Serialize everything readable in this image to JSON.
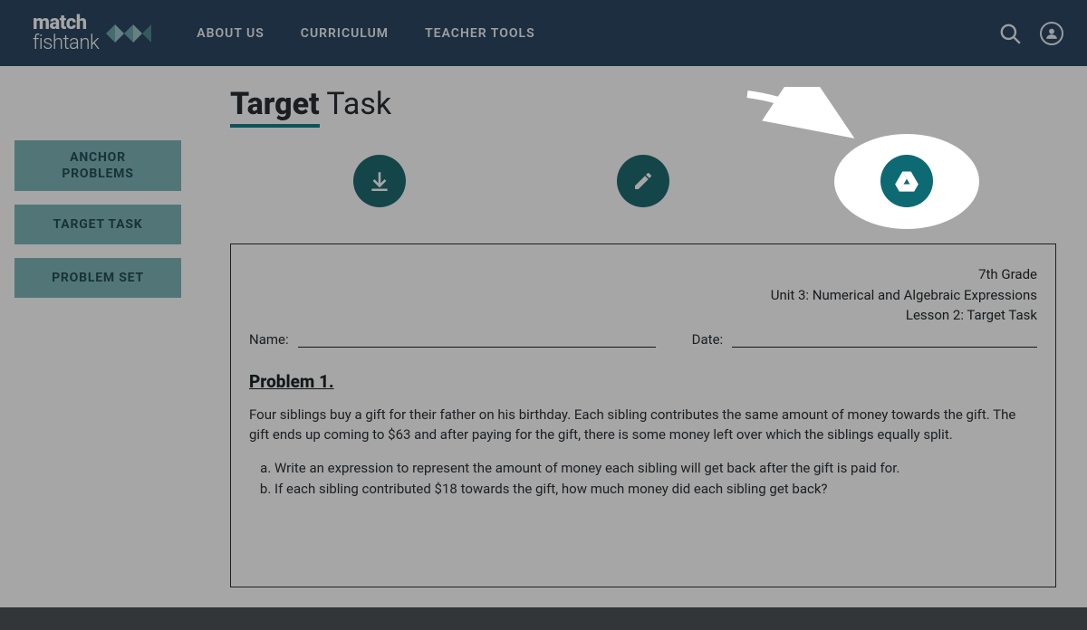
{
  "brand": {
    "bold": "match",
    "thin": "fishtank"
  },
  "nav": {
    "about": "ABOUT US",
    "curriculum": "CURRICULUM",
    "tools": "TEACHER TOOLS"
  },
  "sidebar": {
    "anchor_l1": "ANCHOR",
    "anchor_l2": "PROBLEMS",
    "target": "TARGET TASK",
    "problem_set": "PROBLEM SET"
  },
  "title": {
    "underline": "Target",
    "rest": " Task"
  },
  "doc": {
    "grade": "7th Grade",
    "unit": "Unit 3: Numerical and Algebraic Expressions",
    "lesson": "Lesson 2: Target Task",
    "name_label": "Name:",
    "date_label": "Date:",
    "problem_title": "Problem 1.",
    "problem_body": "Four siblings buy a gift for their father on his birthday. Each sibling contributes the same amount of money towards the gift. The gift ends up coming to $63 and after paying for the gift, there is some money left over which the siblings equally split.",
    "part_a": "Write an expression to represent the amount of money each sibling will get back after the gift is paid for.",
    "part_b": "If each sibling contributed $18 towards the gift, how much money did each sibling get back?"
  }
}
